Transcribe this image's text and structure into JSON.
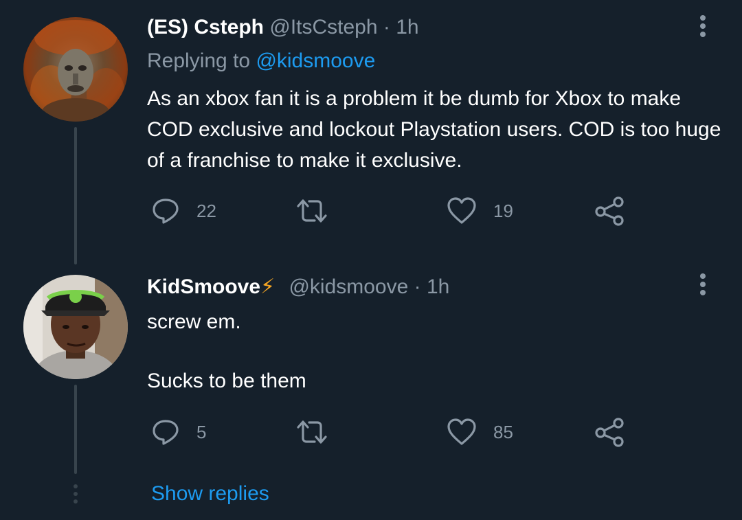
{
  "tweets": [
    {
      "display_name": "(ES) Csteph",
      "handle": "@ItsCsteph",
      "time": "· 1h",
      "replying_label": "Replying to",
      "replying_to": "@kidsmoove",
      "text": "As an xbox fan it is a problem it be dumb for Xbox to make COD exclusive and lockout Playstation users. COD is too huge of a franchise to make it exclusive.",
      "reply_count": "22",
      "retweet_count": "",
      "like_count": "19"
    },
    {
      "display_name": "KidSmoove",
      "badge": "⚡",
      "handle": "@kidsmoove",
      "time": "· 1h",
      "text_line1": "screw em.",
      "text_line2": "Sucks to be them",
      "reply_count": "5",
      "retweet_count": "",
      "like_count": "85"
    }
  ],
  "show_replies": "Show replies",
  "colors": {
    "background": "#15202b",
    "text_primary": "#ffffff",
    "text_secondary": "#8b98a5",
    "link": "#1d9bf0",
    "thread_line": "#38444d"
  },
  "icons": {
    "reply": "reply-icon",
    "retweet": "retweet-icon",
    "like": "heart-icon",
    "share": "share-icon",
    "more": "more-vertical-icon"
  }
}
